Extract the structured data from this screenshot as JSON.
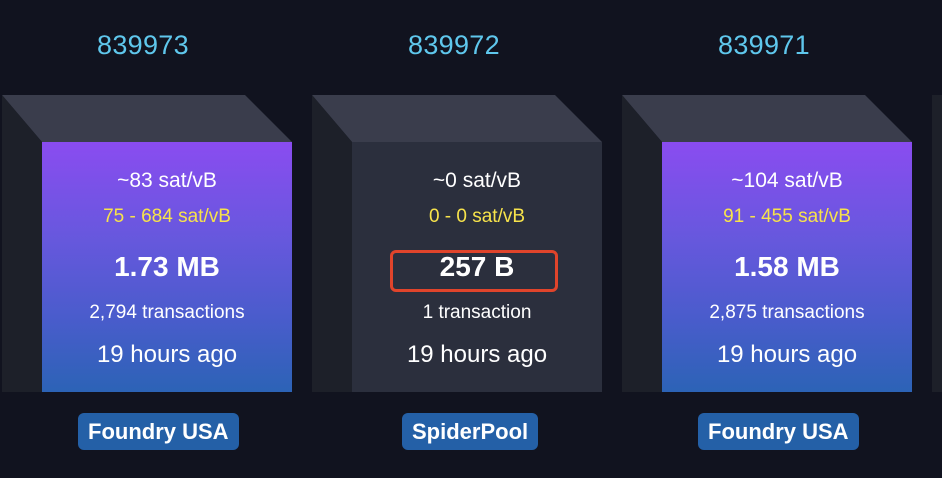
{
  "blocks": [
    {
      "height": "839973",
      "median_fee": "~83 sat/vB",
      "fee_range": "75 - 684 sat/vB",
      "size": "1.73 MB",
      "tx_count": "2,794 transactions",
      "time_ago": "19 hours ago",
      "pool": "Foundry USA"
    },
    {
      "height": "839972",
      "median_fee": "~0 sat/vB",
      "fee_range": "0 - 0 sat/vB",
      "size": "257 B",
      "tx_count": "1 transaction",
      "time_ago": "19 hours ago",
      "pool": "SpiderPool"
    },
    {
      "height": "839971",
      "median_fee": "~104 sat/vB",
      "fee_range": "91 - 455 sat/vB",
      "size": "1.58 MB",
      "tx_count": "2,875 transactions",
      "time_ago": "19 hours ago",
      "pool": "Foundry USA"
    }
  ],
  "colors": {
    "background": "#11131f",
    "height_link": "#5fc7ec",
    "fee_range": "#f7e34b",
    "pool_badge": "#2460a7",
    "highlight_box": "#e0442b",
    "mined_face_top": "#8a4cf0",
    "mined_face_bottom": "#2c63b6",
    "empty_face": "#2b2f3d"
  }
}
